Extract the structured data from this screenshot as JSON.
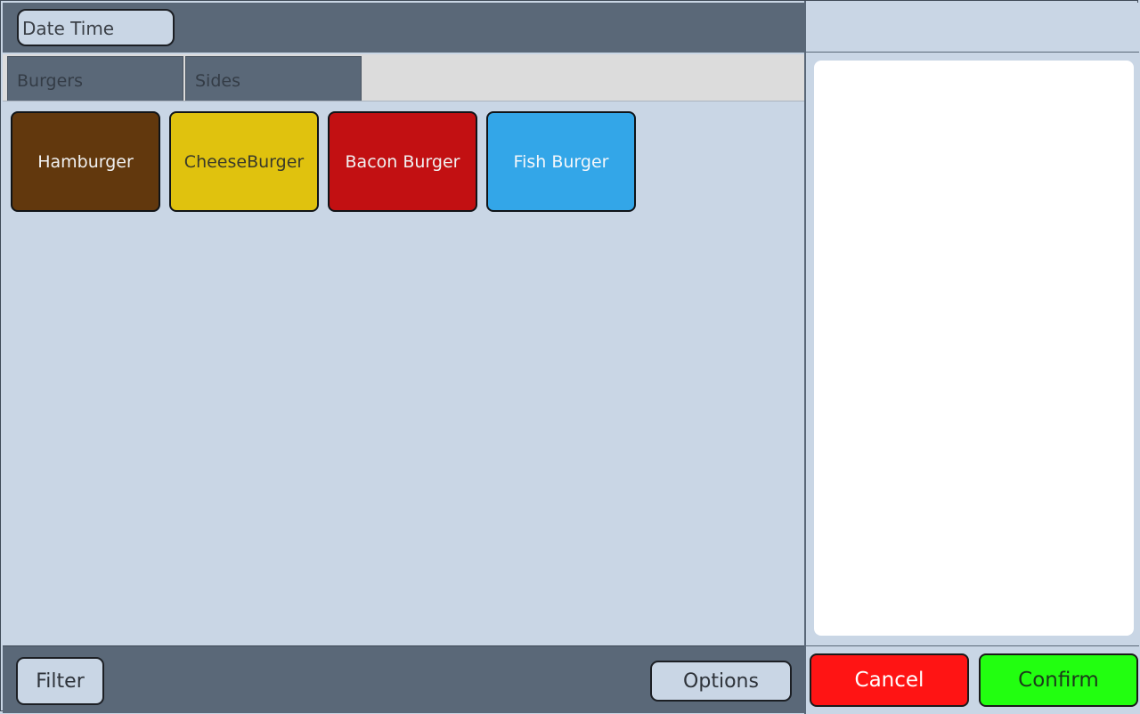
{
  "header": {
    "datetime_label": "Date Time"
  },
  "tabs": [
    {
      "label": "Burgers"
    },
    {
      "label": "Sides"
    }
  ],
  "menu_items": [
    {
      "label": "Hamburger",
      "color": "#62380d"
    },
    {
      "label": "CheeseBurger",
      "color": "#e0c20e"
    },
    {
      "label": "Bacon Burger",
      "color": "#c21012"
    },
    {
      "label": "Fish Burger",
      "color": "#33a6e8"
    }
  ],
  "footer": {
    "filter_label": "Filter",
    "options_label": "Options"
  },
  "order": {
    "cancel_label": "Cancel",
    "confirm_label": "Confirm"
  },
  "colors": {
    "panel_bg": "#c9d6e5",
    "bar_bg": "#5a6878",
    "cancel": "#ff1414",
    "confirm": "#22ff10"
  }
}
